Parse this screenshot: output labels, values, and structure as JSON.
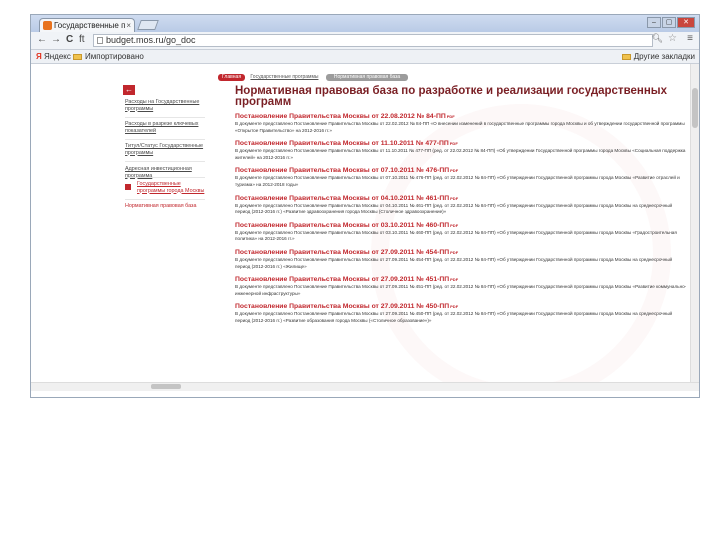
{
  "browser": {
    "tab_title": "Государственные п",
    "tab_close": "×",
    "url": "budget.mos.ru/go_doc",
    "nav": {
      "back": "←",
      "forward": "→",
      "reload": "C",
      "home": "ft"
    },
    "bookmarks": [
      {
        "label": "Яндекс",
        "icon": "yandex-icon"
      },
      {
        "label": "Импортировано",
        "icon": "folder-icon"
      }
    ],
    "other_bookmarks": "Другие закладки",
    "window_buttons": [
      "–",
      "▢",
      "✕"
    ]
  },
  "topnav": {
    "home_label": "Главная",
    "section_label": "Государственные программы",
    "current_label": "Нормативная правовая база"
  },
  "sidebar": {
    "back_icon": "←",
    "items": [
      {
        "label": "Расходы на Государственные программы"
      },
      {
        "label": "Расходы в разрезе ключевых показателей"
      },
      {
        "label": "Титул/Статус Государственные программы"
      },
      {
        "label": "Адресная инвестиционная программа"
      },
      {
        "label": "Государственные программы города Москвы",
        "active": true
      }
    ],
    "footer_link": "Нормативная правовая база"
  },
  "main": {
    "title": "Нормативная правовая база по разработке и реализации государственных программ",
    "documents": [
      {
        "title": "Постановление Правительства Москвы от 22.08.2012 № 84-ПП",
        "desc": "В документе представлено Постановление Правительства Москвы от 22.02.2012 № 84-ПП «О внесении изменений в государственные программы города Москвы и об утверждении государственной программы «Открытое Правительство» на 2012-2016 гг.»"
      },
      {
        "title": "Постановление Правительства Москвы от 11.10.2011 № 477-ПП",
        "desc": "В документе представлено Постановление Правительства Москвы от 11.10.2011 № 477-ПП (ред. от 22.02.2012 № 84-ПП) «Об утверждении Государственной программы города Москвы «Социальная поддержка жителей» на 2012-2016 гг.»"
      },
      {
        "title": "Постановление Правительства Москвы от 07.10.2011 № 476-ПП",
        "desc": "В документе представлено Постановление Правительства Москвы от 07.10.2011 № 476-ПП (ред. от 22.02.2012 № 84-ПП) «Об утверждении Государственной программы города Москвы «Развитие отраслей и туризма» на 2012-2018 годы»"
      },
      {
        "title": "Постановление Правительства Москвы от 04.10.2011 № 461-ПП",
        "desc": "В документе представлено Постановление Правительства Москвы от 04.10.2011 № 461-ПП (ред. от 22.02.2012 № 84-ПП) «Об утверждении Государственной программы города Москвы на среднесрочный период (2012-2016 гг.) «Развитие здравоохранения города Москвы (Столичное здравоохранение)»"
      },
      {
        "title": "Постановление Правительства Москвы от 03.10.2011 № 460-ПП",
        "desc": "В документе представлено Постановление Правительства Москвы от 03.10.2011 № 460-ПП (ред. от 22.02.2012 № 84-ПП) «Об утверждении Государственной программы города Москвы «Градостроительная политика» на 2012-2016 гг.»"
      },
      {
        "title": "Постановление Правительства Москвы от 27.09.2011 № 454-ПП",
        "desc": "В документе представлено Постановление Правительства Москвы от 27.09.2011 № 454-ПП (ред. от 22.02.2012 № 84-ПП) «Об утверждении Государственной программы города Москвы на среднесрочный период (2012-2016 гг.) «Жилище»"
      },
      {
        "title": "Постановление Правительства Москвы от 27.09.2011 № 451-ПП",
        "desc": "В документе представлено Постановление Правительства Москвы от 27.09.2011 № 451-ПП (ред. от 22.02.2012 № 84-ПП) «Об утверждении Государственной программы города Москвы «Развитие коммунально-инженерной инфраструктуры»"
      },
      {
        "title": "Постановление Правительства Москвы от 27.09.2011 № 450-ПП",
        "desc": "В документе представлено Постановление Правительства Москвы от 27.09.2011 № 450-ПП (ред. от 22.02.2012 № 84-ПП) «Об утверждении Государственной программы города Москвы на среднесрочный период (2012-2016 гг.) «Развитие образования города Москвы («Столичное образование»)»"
      }
    ],
    "pdf_badge": "PDF"
  },
  "colors": {
    "accent": "#c1272d",
    "title": "#7a1f24"
  }
}
